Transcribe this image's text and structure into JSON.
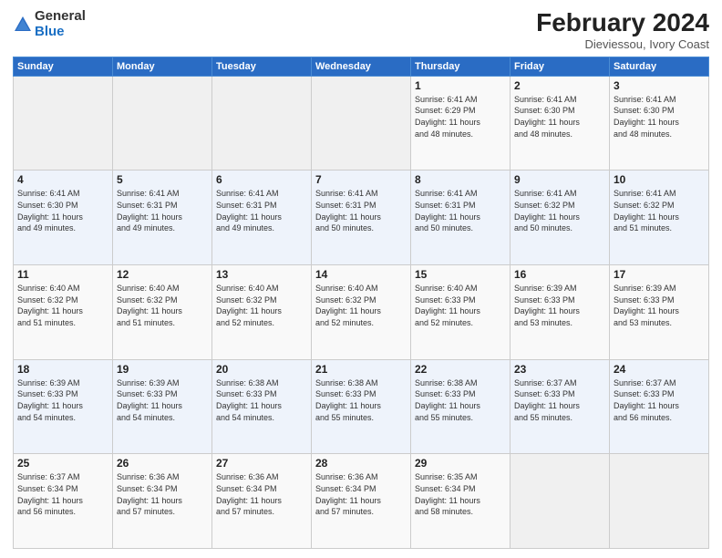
{
  "logo": {
    "general": "General",
    "blue": "Blue"
  },
  "header": {
    "title": "February 2024",
    "subtitle": "Dieviessou, Ivory Coast"
  },
  "columns": [
    "Sunday",
    "Monday",
    "Tuesday",
    "Wednesday",
    "Thursday",
    "Friday",
    "Saturday"
  ],
  "weeks": [
    [
      {
        "day": "",
        "info": ""
      },
      {
        "day": "",
        "info": ""
      },
      {
        "day": "",
        "info": ""
      },
      {
        "day": "",
        "info": ""
      },
      {
        "day": "1",
        "info": "Sunrise: 6:41 AM\nSunset: 6:29 PM\nDaylight: 11 hours\nand 48 minutes."
      },
      {
        "day": "2",
        "info": "Sunrise: 6:41 AM\nSunset: 6:30 PM\nDaylight: 11 hours\nand 48 minutes."
      },
      {
        "day": "3",
        "info": "Sunrise: 6:41 AM\nSunset: 6:30 PM\nDaylight: 11 hours\nand 48 minutes."
      }
    ],
    [
      {
        "day": "4",
        "info": "Sunrise: 6:41 AM\nSunset: 6:30 PM\nDaylight: 11 hours\nand 49 minutes."
      },
      {
        "day": "5",
        "info": "Sunrise: 6:41 AM\nSunset: 6:31 PM\nDaylight: 11 hours\nand 49 minutes."
      },
      {
        "day": "6",
        "info": "Sunrise: 6:41 AM\nSunset: 6:31 PM\nDaylight: 11 hours\nand 49 minutes."
      },
      {
        "day": "7",
        "info": "Sunrise: 6:41 AM\nSunset: 6:31 PM\nDaylight: 11 hours\nand 50 minutes."
      },
      {
        "day": "8",
        "info": "Sunrise: 6:41 AM\nSunset: 6:31 PM\nDaylight: 11 hours\nand 50 minutes."
      },
      {
        "day": "9",
        "info": "Sunrise: 6:41 AM\nSunset: 6:32 PM\nDaylight: 11 hours\nand 50 minutes."
      },
      {
        "day": "10",
        "info": "Sunrise: 6:41 AM\nSunset: 6:32 PM\nDaylight: 11 hours\nand 51 minutes."
      }
    ],
    [
      {
        "day": "11",
        "info": "Sunrise: 6:40 AM\nSunset: 6:32 PM\nDaylight: 11 hours\nand 51 minutes."
      },
      {
        "day": "12",
        "info": "Sunrise: 6:40 AM\nSunset: 6:32 PM\nDaylight: 11 hours\nand 51 minutes."
      },
      {
        "day": "13",
        "info": "Sunrise: 6:40 AM\nSunset: 6:32 PM\nDaylight: 11 hours\nand 52 minutes."
      },
      {
        "day": "14",
        "info": "Sunrise: 6:40 AM\nSunset: 6:32 PM\nDaylight: 11 hours\nand 52 minutes."
      },
      {
        "day": "15",
        "info": "Sunrise: 6:40 AM\nSunset: 6:33 PM\nDaylight: 11 hours\nand 52 minutes."
      },
      {
        "day": "16",
        "info": "Sunrise: 6:39 AM\nSunset: 6:33 PM\nDaylight: 11 hours\nand 53 minutes."
      },
      {
        "day": "17",
        "info": "Sunrise: 6:39 AM\nSunset: 6:33 PM\nDaylight: 11 hours\nand 53 minutes."
      }
    ],
    [
      {
        "day": "18",
        "info": "Sunrise: 6:39 AM\nSunset: 6:33 PM\nDaylight: 11 hours\nand 54 minutes."
      },
      {
        "day": "19",
        "info": "Sunrise: 6:39 AM\nSunset: 6:33 PM\nDaylight: 11 hours\nand 54 minutes."
      },
      {
        "day": "20",
        "info": "Sunrise: 6:38 AM\nSunset: 6:33 PM\nDaylight: 11 hours\nand 54 minutes."
      },
      {
        "day": "21",
        "info": "Sunrise: 6:38 AM\nSunset: 6:33 PM\nDaylight: 11 hours\nand 55 minutes."
      },
      {
        "day": "22",
        "info": "Sunrise: 6:38 AM\nSunset: 6:33 PM\nDaylight: 11 hours\nand 55 minutes."
      },
      {
        "day": "23",
        "info": "Sunrise: 6:37 AM\nSunset: 6:33 PM\nDaylight: 11 hours\nand 55 minutes."
      },
      {
        "day": "24",
        "info": "Sunrise: 6:37 AM\nSunset: 6:33 PM\nDaylight: 11 hours\nand 56 minutes."
      }
    ],
    [
      {
        "day": "25",
        "info": "Sunrise: 6:37 AM\nSunset: 6:34 PM\nDaylight: 11 hours\nand 56 minutes."
      },
      {
        "day": "26",
        "info": "Sunrise: 6:36 AM\nSunset: 6:34 PM\nDaylight: 11 hours\nand 57 minutes."
      },
      {
        "day": "27",
        "info": "Sunrise: 6:36 AM\nSunset: 6:34 PM\nDaylight: 11 hours\nand 57 minutes."
      },
      {
        "day": "28",
        "info": "Sunrise: 6:36 AM\nSunset: 6:34 PM\nDaylight: 11 hours\nand 57 minutes."
      },
      {
        "day": "29",
        "info": "Sunrise: 6:35 AM\nSunset: 6:34 PM\nDaylight: 11 hours\nand 58 minutes."
      },
      {
        "day": "",
        "info": ""
      },
      {
        "day": "",
        "info": ""
      }
    ]
  ]
}
